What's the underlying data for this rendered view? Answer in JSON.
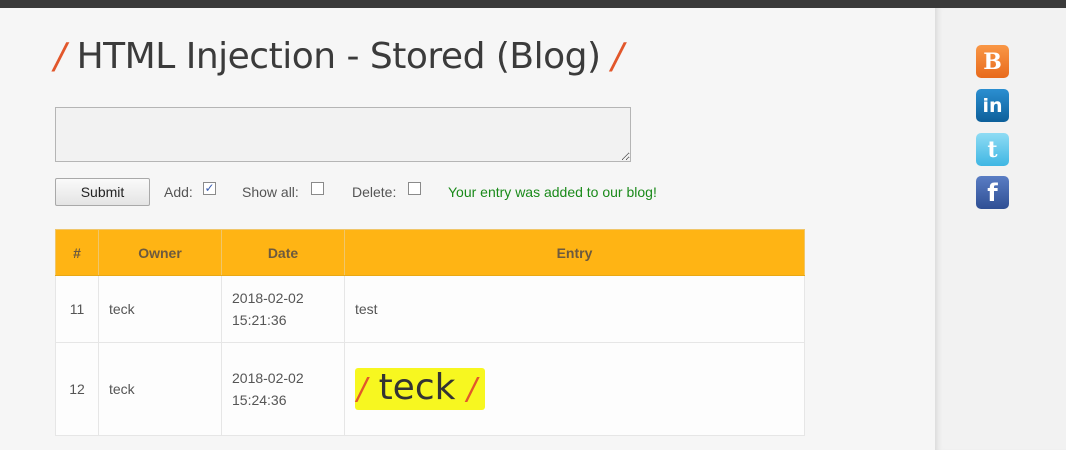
{
  "page": {
    "title": "HTML Injection - Stored (Blog)",
    "title_deco": "/"
  },
  "form": {
    "entry_value": "",
    "submit_label": "Submit",
    "add_label": "Add:",
    "add_checked": true,
    "show_all_label": "Show all:",
    "show_all_checked": false,
    "delete_label": "Delete:",
    "delete_checked": false,
    "check_glyph": "✓",
    "status_message": "Your entry was added to our blog!"
  },
  "table": {
    "columns": [
      "#",
      "Owner",
      "Date",
      "Entry"
    ],
    "rows": [
      {
        "id": "11",
        "owner": "teck",
        "date": "2018-02-02",
        "time": "15:21:36",
        "entry": "test"
      },
      {
        "id": "12",
        "owner": "teck",
        "date": "2018-02-02",
        "time": "15:24:36",
        "entry": "teck",
        "entry_deco": "/"
      }
    ]
  },
  "social": {
    "blogger": {
      "icon": "blogger-icon",
      "glyph": "B",
      "color": "#f57d00"
    },
    "linkedin": {
      "icon": "linkedin-icon",
      "glyph": "in",
      "color": "#0e76a8"
    },
    "twitter": {
      "icon": "twitter-icon",
      "glyph": "t",
      "color": "#55acee"
    },
    "facebook": {
      "icon": "facebook-icon",
      "glyph": "f",
      "color": "#3b5998"
    }
  },
  "colors": {
    "header_orange": "#ffb414",
    "status_green": "#1a8a1a",
    "highlight_yellow": "#f7f720",
    "accent_red": "#e2572b"
  }
}
